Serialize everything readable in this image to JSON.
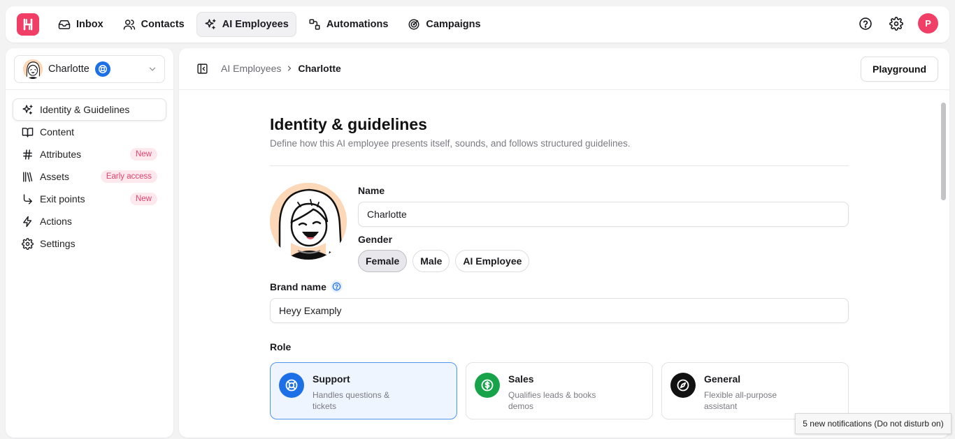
{
  "nav": {
    "items": [
      {
        "label": "Inbox",
        "icon": "inbox-icon"
      },
      {
        "label": "Contacts",
        "icon": "contacts-icon"
      },
      {
        "label": "AI Employees",
        "icon": "sparkles-icon",
        "active": true
      },
      {
        "label": "Automations",
        "icon": "automations-icon"
      },
      {
        "label": "Campaigns",
        "icon": "campaigns-icon"
      }
    ],
    "user_initial": "P",
    "brand_color": "#f03e67"
  },
  "sidebar": {
    "employee_name": "Charlotte",
    "items": [
      {
        "label": "Identity & Guidelines",
        "icon": "sparkles-icon",
        "active": true,
        "tag": ""
      },
      {
        "label": "Content",
        "icon": "book-icon",
        "tag": ""
      },
      {
        "label": "Attributes",
        "icon": "hash-icon",
        "tag": "New"
      },
      {
        "label": "Assets",
        "icon": "library-icon",
        "tag": "Early access"
      },
      {
        "label": "Exit points",
        "icon": "corner-down-right-icon",
        "tag": "New"
      },
      {
        "label": "Actions",
        "icon": "zap-icon",
        "tag": ""
      },
      {
        "label": "Settings",
        "icon": "gear-icon",
        "tag": ""
      }
    ]
  },
  "header": {
    "breadcrumb_parent": "AI Employees",
    "breadcrumb_current": "Charlotte",
    "playground_label": "Playground"
  },
  "page": {
    "title": "Identity & guidelines",
    "subtitle": "Define how this AI employee presents itself, sounds, and follows structured guidelines.",
    "name_label": "Name",
    "name_value": "Charlotte",
    "gender_label": "Gender",
    "gender_options": [
      "Female",
      "Male",
      "AI Employee"
    ],
    "gender_selected": "Female",
    "brand_label": "Brand name",
    "brand_value": "Heyy Examply",
    "role_label": "Role",
    "roles": [
      {
        "title": "Support",
        "desc": "Handles questions & tickets",
        "icon": "lifebuoy-icon",
        "color": "#1d6fe8",
        "selected": true
      },
      {
        "title": "Sales",
        "desc": "Qualifies leads & books demos",
        "icon": "dollar-icon",
        "color": "#17a34a",
        "selected": false
      },
      {
        "title": "General",
        "desc": "Flexible all-purpose assistant",
        "icon": "compass-icon",
        "color": "#111111",
        "selected": false
      }
    ]
  },
  "toast": {
    "text": "5 new notifications (Do not disturb on)"
  }
}
